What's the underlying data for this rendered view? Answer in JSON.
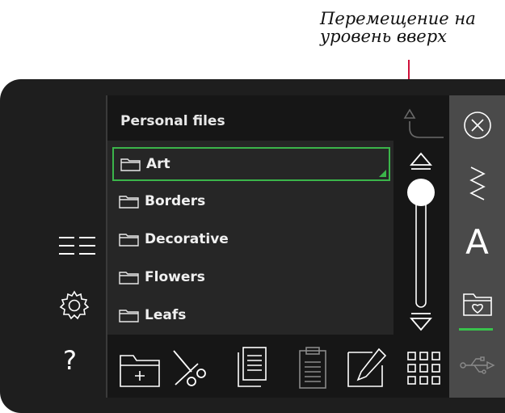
{
  "callout": {
    "line1": "Перемещение на",
    "line2": "уровень вверх"
  },
  "panel": {
    "title": "Personal files"
  },
  "files": [
    {
      "name": "Art",
      "selected": true
    },
    {
      "name": "Borders",
      "selected": false
    },
    {
      "name": "Decorative",
      "selected": false
    },
    {
      "name": "Flowers",
      "selected": false
    },
    {
      "name": "Leafs",
      "selected": false
    }
  ],
  "left_icons": [
    "list-view-icon",
    "gear-icon",
    "help-icon"
  ],
  "left_labels": {
    "help": "?"
  },
  "toolbar": [
    "new-folder-icon",
    "cut-icon",
    "copy-icon",
    "paste-icon",
    "rename-icon",
    "grid-view-icon"
  ],
  "right_bar": [
    "close-icon",
    "stitch-icon",
    "font-icon",
    "personal-files-icon",
    "usb-icon"
  ],
  "right_labels": {
    "font": "A"
  },
  "colors": {
    "accent_green": "#3bb54a",
    "callout_line": "#d0103a",
    "panel_bg": "#161616",
    "list_bg": "#262626",
    "right_bar_bg": "#4a4a4a"
  }
}
